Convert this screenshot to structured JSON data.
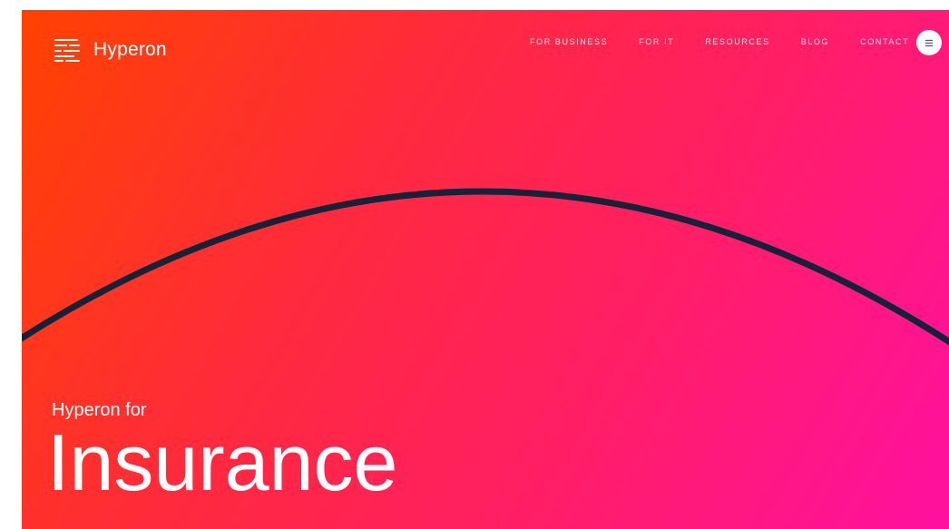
{
  "header": {
    "brand": "Hyperon",
    "nav": [
      {
        "label": "FOR BUSINESS"
      },
      {
        "label": "FOR IT"
      },
      {
        "label": "RESOURCES"
      },
      {
        "label": "BLOG"
      },
      {
        "label": "CONTACT"
      }
    ]
  },
  "hero": {
    "subtitle": "Hyperon for",
    "title": "Insurance"
  },
  "icons": {
    "logo": "logo-lines-icon",
    "menu": "hamburger-menu-icon"
  },
  "colors": {
    "gradient_start": "#ff4200",
    "gradient_end": "#ff10a0",
    "arc": "#13233a",
    "text": "#ffffff"
  }
}
